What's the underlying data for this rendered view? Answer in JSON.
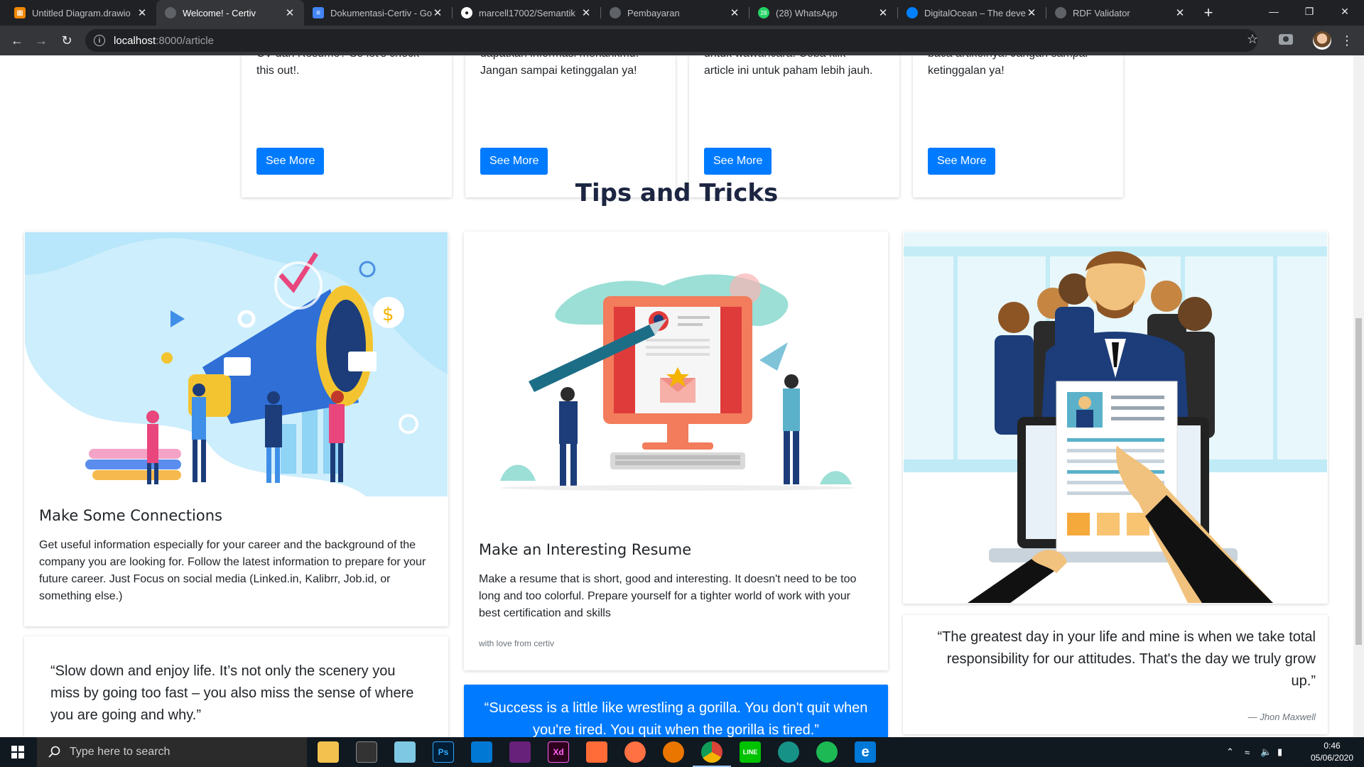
{
  "browser": {
    "tabs": [
      {
        "label": "Untitled Diagram.drawio",
        "favicon": "drawio-icon",
        "color": "#f08705"
      },
      {
        "label": "Welcome! - Certiv",
        "favicon": "globe-icon",
        "color": "#5f6368"
      },
      {
        "label": "Dokumentasi-Certiv - Google Docs",
        "favicon": "docs-icon",
        "color": "#4285f4"
      },
      {
        "label": "marcell17002/Semantik",
        "favicon": "github-icon",
        "color": "#ffffff"
      },
      {
        "label": "Pembayaran",
        "favicon": "globe-icon",
        "color": "#5f6368"
      },
      {
        "label": "(28) WhatsApp",
        "favicon": "whatsapp-icon",
        "color": "#25d366",
        "badge": "28"
      },
      {
        "label": "DigitalOcean – The developer cloud",
        "favicon": "digitalocean-icon",
        "color": "#0080ff"
      },
      {
        "label": "RDF Validator",
        "favicon": "globe-icon",
        "color": "#5f6368"
      }
    ],
    "url_host": "localhost",
    "url_path": ":8000/article"
  },
  "articles": [
    {
      "text_line1": "CV dan Resume? So let's check",
      "text_line2": "this out!.",
      "button": "See More"
    },
    {
      "text_line1": "dapatkan informasi menarikmu.",
      "text_line2": "Jangan sampai ketinggalan ya!",
      "button": "See More"
    },
    {
      "text_line1": "untuk wawancara. Coba klik",
      "text_line2": "article ini untuk paham lebih jauh.",
      "button": "See More"
    },
    {
      "text_line1": "baca artikelnya. Jangan sampai",
      "text_line2": "ketinggalan ya!",
      "button": "See More"
    }
  ],
  "tips": {
    "section_title": "Tips and Tricks",
    "cards": [
      {
        "title": "Make Some Connections",
        "text": "Get useful information especially for your career and the background of the company you are looking for. Follow the latest information to prepare for your future career. Just Focus on social media (Linked.in, Kalibrr, Job.id, or something else.)"
      },
      {
        "title": "Make an Interesting Resume",
        "text": "Make a resume that is short, good and interesting. It doesn't need to be too long and too colorful. Prepare yourself for a tighter world of work with your best certification and skills",
        "footer": "with love from certiv"
      }
    ],
    "quotes": [
      {
        "text": "“Slow down and enjoy life. It’s not only the scenery you miss by going too fast – you also miss the sense of where you are going and why.”"
      },
      {
        "text": "“Success is a little like wrestling a gorilla. You don't quit when you're tired. You quit when the gorilla is tired.”"
      },
      {
        "text": "“The greatest day in your life and mine is when we take total responsibility for our attitudes. That's the day we truly grow up.”",
        "author": "—  Jhon Maxwell"
      }
    ]
  },
  "taskbar": {
    "search_placeholder": "Type here to search",
    "time": "0:46",
    "date": "05/06/2020",
    "apps": [
      {
        "name": "file-explorer-icon",
        "label": "",
        "color": "#f2c14e"
      },
      {
        "name": "terminal-icon",
        "label": "",
        "color": "#333333"
      },
      {
        "name": "notes-icon",
        "label": "",
        "color": "#7ec8e3"
      },
      {
        "name": "photoshop-icon",
        "label": "Ps",
        "color": "#001e36"
      },
      {
        "name": "vscode-icon",
        "label": "",
        "color": "#0078d4"
      },
      {
        "name": "visual-studio-icon",
        "label": "",
        "color": "#68217a"
      },
      {
        "name": "adobe-xd-icon",
        "label": "Xd",
        "color": "#2e001e"
      },
      {
        "name": "postman-icon",
        "label": "",
        "color": "#ff6c37"
      },
      {
        "name": "compass-icon",
        "label": "",
        "color": "#ff7043"
      },
      {
        "name": "blender-icon",
        "label": "",
        "color": "#ea7600"
      },
      {
        "name": "chrome-icon",
        "label": "",
        "color": "#4285f4"
      },
      {
        "name": "line-icon",
        "label": "LINE",
        "color": "#00c300"
      },
      {
        "name": "gitkraken-icon",
        "label": "",
        "color": "#179287"
      },
      {
        "name": "spotify-icon",
        "label": "",
        "color": "#1db954"
      },
      {
        "name": "edge-icon",
        "label": "e",
        "color": "#0078d7"
      }
    ]
  }
}
